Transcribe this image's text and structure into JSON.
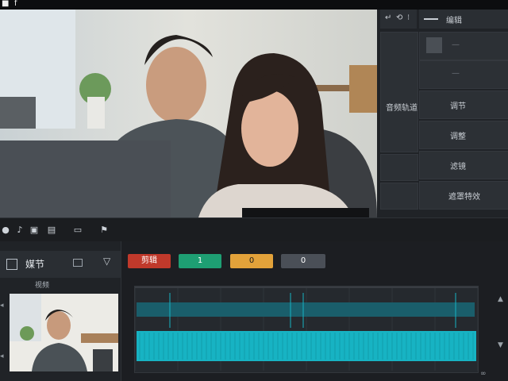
{
  "topbar": {
    "left_glyph": "■",
    "right_glyph": "f"
  },
  "right_panel": {
    "header_icons": [
      "↵",
      "⟲",
      "⁝"
    ],
    "header_title": "编辑",
    "left_label": "音频轨道",
    "rows": [
      "—",
      "—",
      "调节",
      "调整",
      "滤镜",
      "遮罩特效"
    ]
  },
  "toolbar": {
    "icons": [
      "dot-icon",
      "speaker-icon",
      "film-icon",
      "minus-icon",
      "crop-icon"
    ]
  },
  "left_panel": {
    "title": "媒节",
    "sub_label": "视频"
  },
  "timeline": {
    "chips": [
      {
        "label": "剪辑",
        "color": "#c0392b"
      },
      {
        "label": "1",
        "color": "#1e9f73"
      },
      {
        "label": "0",
        "color": "#e2a23a"
      },
      {
        "label": "0",
        "color": "#4a4f57"
      }
    ],
    "right_markers": [
      "▲",
      "▼",
      "∞"
    ]
  },
  "colors": {
    "accent": "#17b3c3",
    "track_dark": "#1a5e6b"
  }
}
